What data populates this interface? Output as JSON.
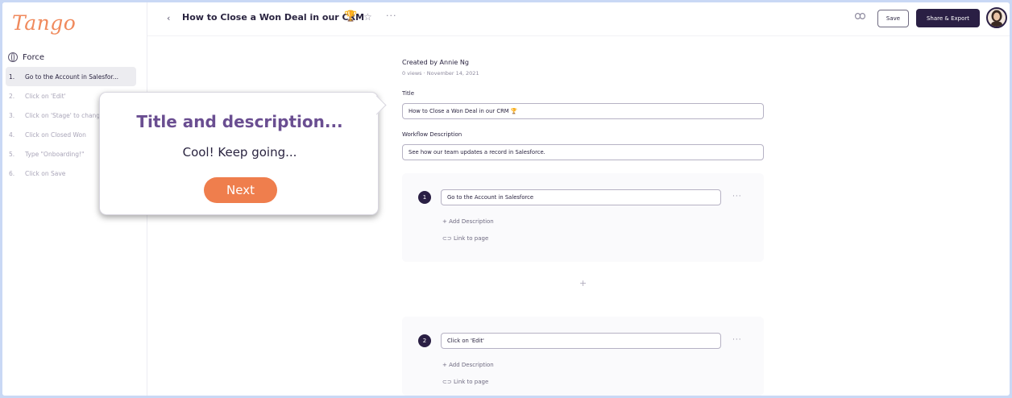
{
  "app": {
    "logo": "Tango"
  },
  "sidebar": {
    "brand": "Force",
    "steps": [
      {
        "num": "1.",
        "label": "Go to the Account in Salesfor..."
      },
      {
        "num": "2.",
        "label": "Click on 'Edit'"
      },
      {
        "num": "3.",
        "label": "Click on 'Stage' to chang"
      },
      {
        "num": "4.",
        "label": "Click on Closed Won"
      },
      {
        "num": "5.",
        "label": "Type \"Onboarding!\""
      },
      {
        "num": "6.",
        "label": "Click on Save"
      }
    ]
  },
  "header": {
    "back_glyph": "‹",
    "title": "How to Close a Won Deal in our CRM",
    "trophy_glyph": "🏆",
    "star_glyph": "☆",
    "more_glyph": "···",
    "save_label": "Save",
    "share_label": "Share & Export"
  },
  "meta": {
    "author": "Created by Annie Ng",
    "sub": "0 views · November 14, 2021"
  },
  "form": {
    "title_label": "Title",
    "title_value": "How to Close a Won Deal in our CRM 🏆",
    "desc_label": "Workflow Description",
    "desc_value": "See how our team updates a record in Salesforce."
  },
  "steps": [
    {
      "num": "1",
      "value": "Go to the Account in Salesforce",
      "add_desc": "+ Add Description",
      "link": "Link to page",
      "more": "···"
    },
    {
      "num": "2",
      "value": "Click on 'Edit'",
      "add_desc": "+ Add Description",
      "link": "Link to page",
      "more": "···"
    }
  ],
  "add_step_glyph": "+",
  "tooltip": {
    "title": "Title and description...",
    "body": "Cool! Keep going...",
    "next_label": "Next"
  },
  "colors": {
    "accent_orange": "#ef7e4d",
    "dark_purple": "#2a1f44",
    "tooltip_purple": "#6a4e91",
    "page_bg": "#c9d8f5"
  }
}
